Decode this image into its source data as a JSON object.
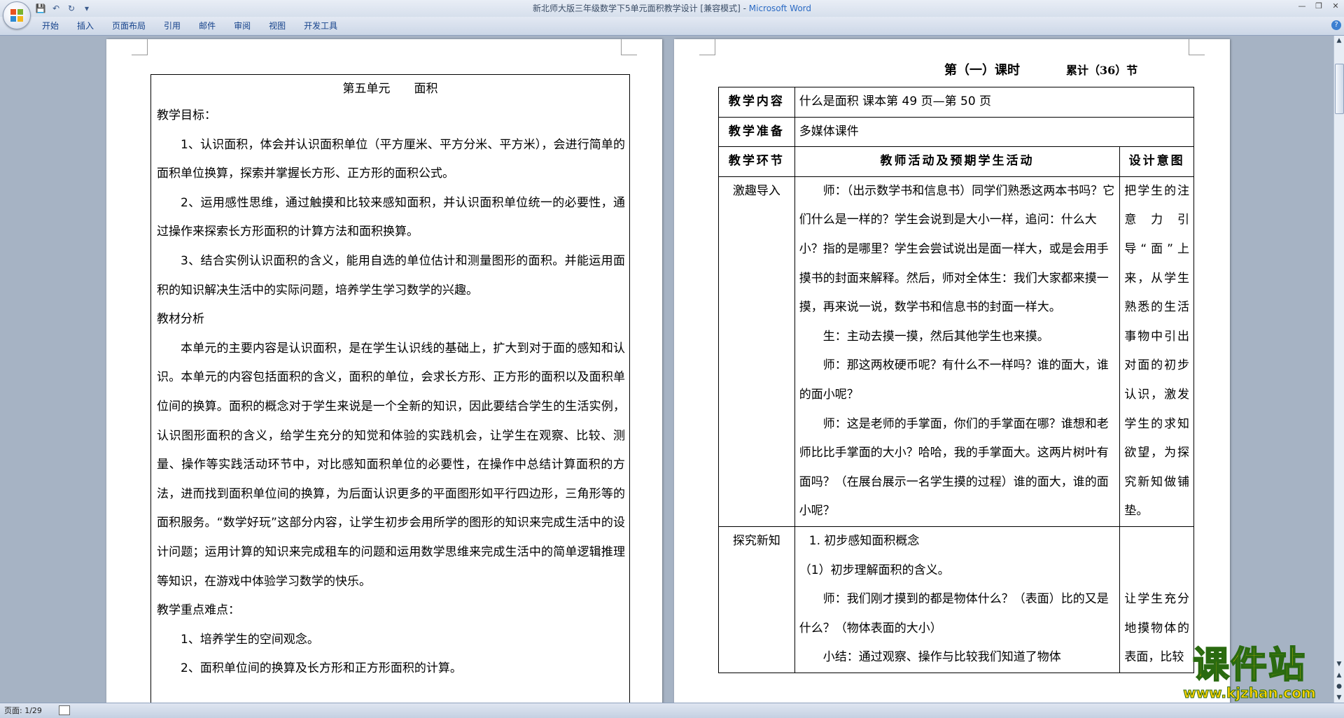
{
  "window": {
    "title": "新北师大版三年级数学下5单元面积教学设计 [兼容模式]",
    "app_name": "Microsoft Word"
  },
  "qat": {
    "save_icon": "save-icon",
    "undo_icon": "undo-icon",
    "redo_icon": "redo-icon",
    "customize_icon": "customize-qat-icon"
  },
  "ribbon": {
    "tabs": [
      "开始",
      "插入",
      "页面布局",
      "引用",
      "邮件",
      "审阅",
      "视图",
      "开发工具"
    ]
  },
  "page1": {
    "title": "第五单元　　面积",
    "heading_goals": "教学目标：",
    "goals": [
      "1、认识面积，体会并认识面积单位（平方厘米、平方分米、平方米），会进行简单的面积单位换算，探索并掌握长方形、正方形的面积公式。",
      "2、运用感性思维，通过触摸和比较来感知面积，并认识面积单位统一的必要性，通过操作来探索长方形面积的计算方法和面积换算。",
      "3、结合实例认识面积的含义，能用自选的单位估计和测量图形的面积。并能运用面积的知识解决生活中的实际问题，培养学生学习数学的兴趣。"
    ],
    "heading_analysis": "教材分析",
    "analysis": "本单元的主要内容是认识面积，是在学生认识线的基础上，扩大到对于面的感知和认识。本单元的内容包括面积的含义，面积的单位，会求长方形、正方形的面积以及面积单位间的换算。面积的概念对于学生来说是一个全新的知识，因此要结合学生的生活实例，认识图形面积的含义，给学生充分的知觉和体验的实践机会，让学生在观察、比较、测量、操作等实践活动环节中，对比感知面积单位的必要性，在操作中总结计算面积的方法，进而找到面积单位间的换算，为后面认识更多的平面图形如平行四边形，三角形等的面积服务。“数学好玩”这部分内容，让学生初步会用所学的图形的知识来完成生活中的设计问题；运用计算的知识来完成租车的问题和运用数学思维来完成生活中的简单逻辑推理等知识，在游戏中体验学习数学的快乐。",
    "heading_key": "教学重点难点：",
    "key_points": [
      "1、培养学生的空间观念。",
      "2、面积单位间的换算及长方形和正方形面积的计算。"
    ]
  },
  "page2": {
    "lesson_no": "第（一）课时",
    "total": "累计（36）节",
    "row1_label": "教学内容",
    "row1_value": "什么是面积 课本第 49 页—第 50 页",
    "row2_label": "教学准备",
    "row2_value": "多媒体课件",
    "col_stage": "教学环节",
    "col_activity": "教师活动及预期学生活动",
    "col_intent": "设计意图",
    "stage1": "激趣导入",
    "stage1_activity": [
      "师：（出示数学书和信息书）同学们熟悉这两本书吗？它们什么是一样的？学生会说到是大小一样，追问：什么大小？指的是哪里？学生会尝试说出是面一样大，或是会用手摸书的封面来解释。然后，师对全体生：我们大家都来摸一摸，再来说一说，数学书和信息书的封面一样大。",
      "生：主动去摸一摸，然后其他学生也来摸。",
      "师：那这两枚硬币呢？有什么不一样吗？谁的面大，谁的面小呢？",
      "师：这是老师的手掌面，你们的手掌面在哪？谁想和老师比比手掌面的大小？哈哈，我的手掌面大。这两片树叶有面吗？（在展台展示一名学生摸的过程）谁的面大，谁的面小呢？"
    ],
    "stage1_intent": "把学生的注意力引导“面”上来，从学生熟悉的生活事物中引出对面的初步认识，激发学生的求知欲望，为探究新知做铺垫。",
    "stage2": "探究新知",
    "stage2_activity": [
      "1. 初步感知面积概念",
      "（1）初步理解面积的含义。",
      "师：我们刚才摸到的都是物体什么？（表面）比的又是什么？（物体表面的大小）",
      "小结：通过观察、操作与比较我们知道了物体"
    ],
    "stage2_intent": "让学生充分地摸物体的表面，比较"
  },
  "status": {
    "page_info": "页面: 1/29"
  },
  "watermark": {
    "brand": "课件站",
    "url": "www.kjzhan.com"
  }
}
